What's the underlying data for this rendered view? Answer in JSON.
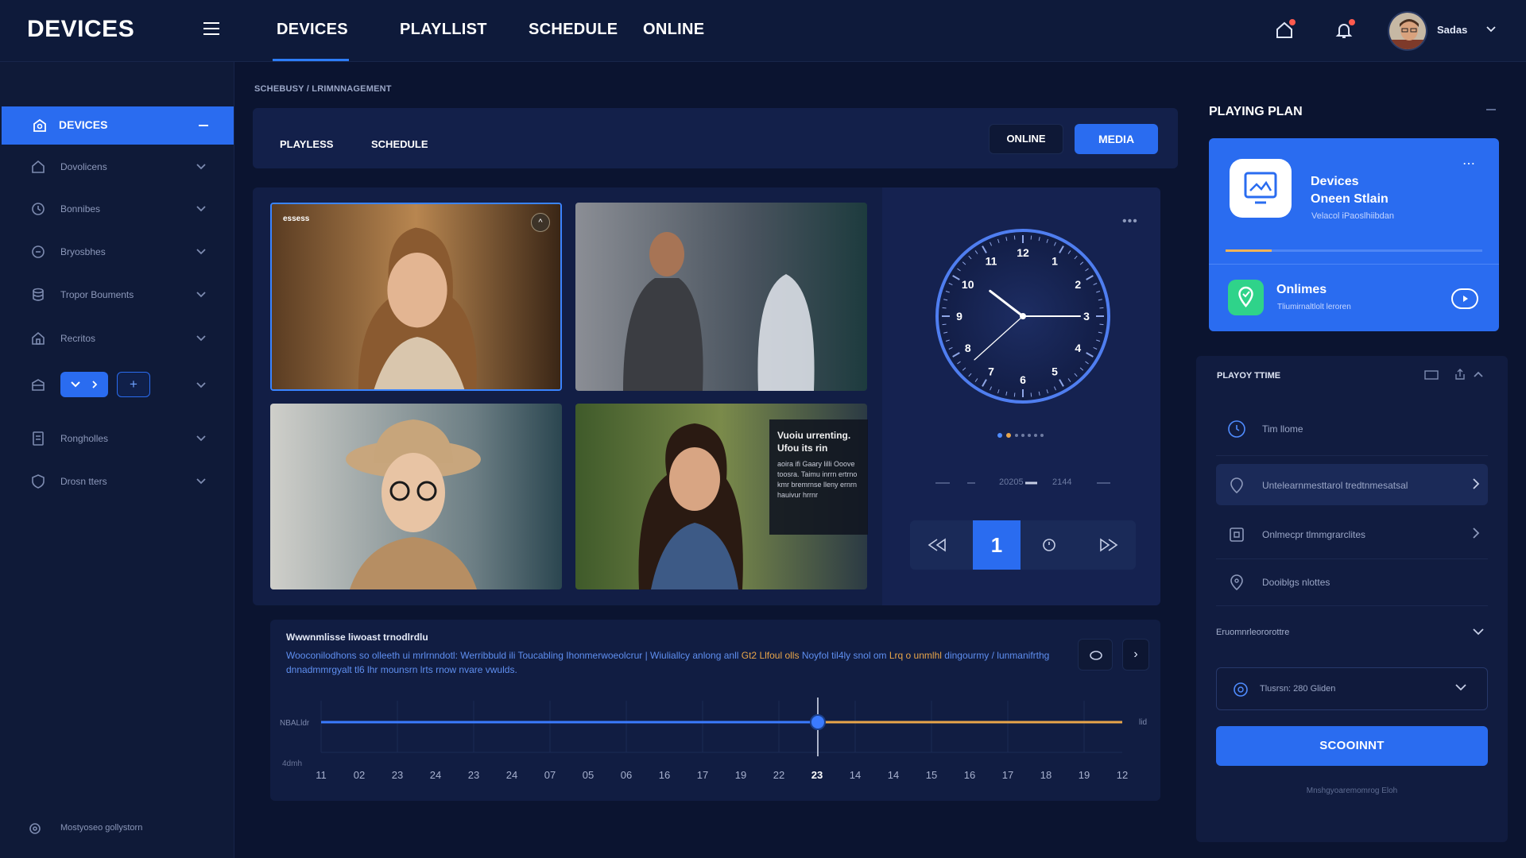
{
  "app": {
    "logo": "DEVICES",
    "accent": "#2a6cf0",
    "highlight": "#e8a54a"
  },
  "topnav": {
    "tabs": [
      {
        "label": "DEVICES",
        "active": true
      },
      {
        "label": "PLAYLLIST",
        "active": false
      },
      {
        "label": "SCHEDULE",
        "active": false
      },
      {
        "label": "ONLINE",
        "active": false
      }
    ],
    "username": "Sadas",
    "icons": [
      "menu-icon",
      "home-alert-icon",
      "bell-icon",
      "chevron-down-icon"
    ]
  },
  "sidebar": {
    "active_label": "DEVICES",
    "items": [
      {
        "label": "Dovolicens",
        "icon": "home-icon"
      },
      {
        "label": "Bonnibes",
        "icon": "clock-icon"
      },
      {
        "label": "Bryosbhes",
        "icon": "clock-icon"
      },
      {
        "label": "Tropor Bouments",
        "icon": "database-icon"
      },
      {
        "label": "Recritos",
        "icon": "home-icon"
      },
      {
        "label": "",
        "icon": "box-icon"
      },
      {
        "label": "Rongholles",
        "icon": "document-icon"
      },
      {
        "label": "Drosn tters",
        "icon": "shield-icon"
      }
    ],
    "pill_plus": "+",
    "footer_label": "Mostyoseo gollystorn"
  },
  "breadcrumb": "SCHEBUSY / LRIMNNAGEMENT",
  "main": {
    "tabs": [
      "PLAYLESS",
      "SCHEDULE"
    ],
    "online_button": "ONLINE",
    "media_button": "MEDIA",
    "thumb_badge": "essess",
    "thumb_up": "^",
    "overlay_title": "Vuoiu urrenting. Ufou its rin",
    "overlay_body": "aoira ifi Gaary lilli Ooove toosra. Taimu inrrn ertrno kmr bremrnse lleny ernrn hauivur hrrnr",
    "clock": {
      "hour": 10,
      "minute": 15,
      "second": 38
    },
    "range": {
      "start": "20205",
      "end": "2144"
    },
    "player_current": "1",
    "player_icons": [
      "rewind-icon",
      "timer-icon",
      "forward-icon"
    ]
  },
  "timeline": {
    "title": "Wwwnmlisse liwoast trnodlrdlu",
    "desc_a": "Wooconilodhons so olleeth ui mrlrnndotl: Werribbuld ili Toucabling Ihonmerwoeolcrur  |  Wiuliallcy anlong anll",
    "desc_hl_a": "Gt2 Llfoul olls",
    "desc_b": "Noyfol til4ly snol om",
    "desc_hl_b": "Lrq o unmlhl",
    "desc_c": "dingourmy / lunmanifrthg dnnadmmrgyalt tl6 lhr mounsrn lrts rnow nvare vwulds.",
    "ylabel_top": "NBALldr",
    "ylabel_bottom": "4dmh",
    "yright": "lid",
    "btn_next": "›",
    "ticks": [
      "11",
      "02",
      "23",
      "24",
      "23",
      "24",
      "07",
      "05",
      "06",
      "16",
      "17",
      "19",
      "22",
      "23",
      "14",
      "14",
      "15",
      "16",
      "17",
      "18",
      "19",
      "12"
    ],
    "current_index": 13,
    "progress": 0.62
  },
  "playing_plan": {
    "title": "PLAYING PLAN",
    "device_title": "Devices",
    "device_title_2": "Oneen Stlain",
    "device_sub": "Velacol iPaoslhiibdan",
    "progress": 0.18,
    "online_title": "Onlimes",
    "online_sub": "Tliumirnaltlolt leroren"
  },
  "playing_time": {
    "title": "PLAYOY TTIME",
    "rows": [
      {
        "label": "Tim llome",
        "icon": "timer-icon",
        "chevron": false
      },
      {
        "label": "Untelearnmesttarol tredtnmesatsal",
        "icon": "location-icon",
        "chevron": true
      },
      {
        "label": "Onlmecpr tlmmgrarclites",
        "icon": "grid-icon",
        "chevron": true
      },
      {
        "label": "Dooiblgs nlottes",
        "icon": "pin-icon",
        "chevron": false
      }
    ],
    "env_label": "Eruomnrleororottre",
    "select_value": "Tlusrsn: 280 Gliden",
    "submit": "SCOOINNT",
    "submit_note": "Mnshgyoaremomrog Eloh"
  }
}
